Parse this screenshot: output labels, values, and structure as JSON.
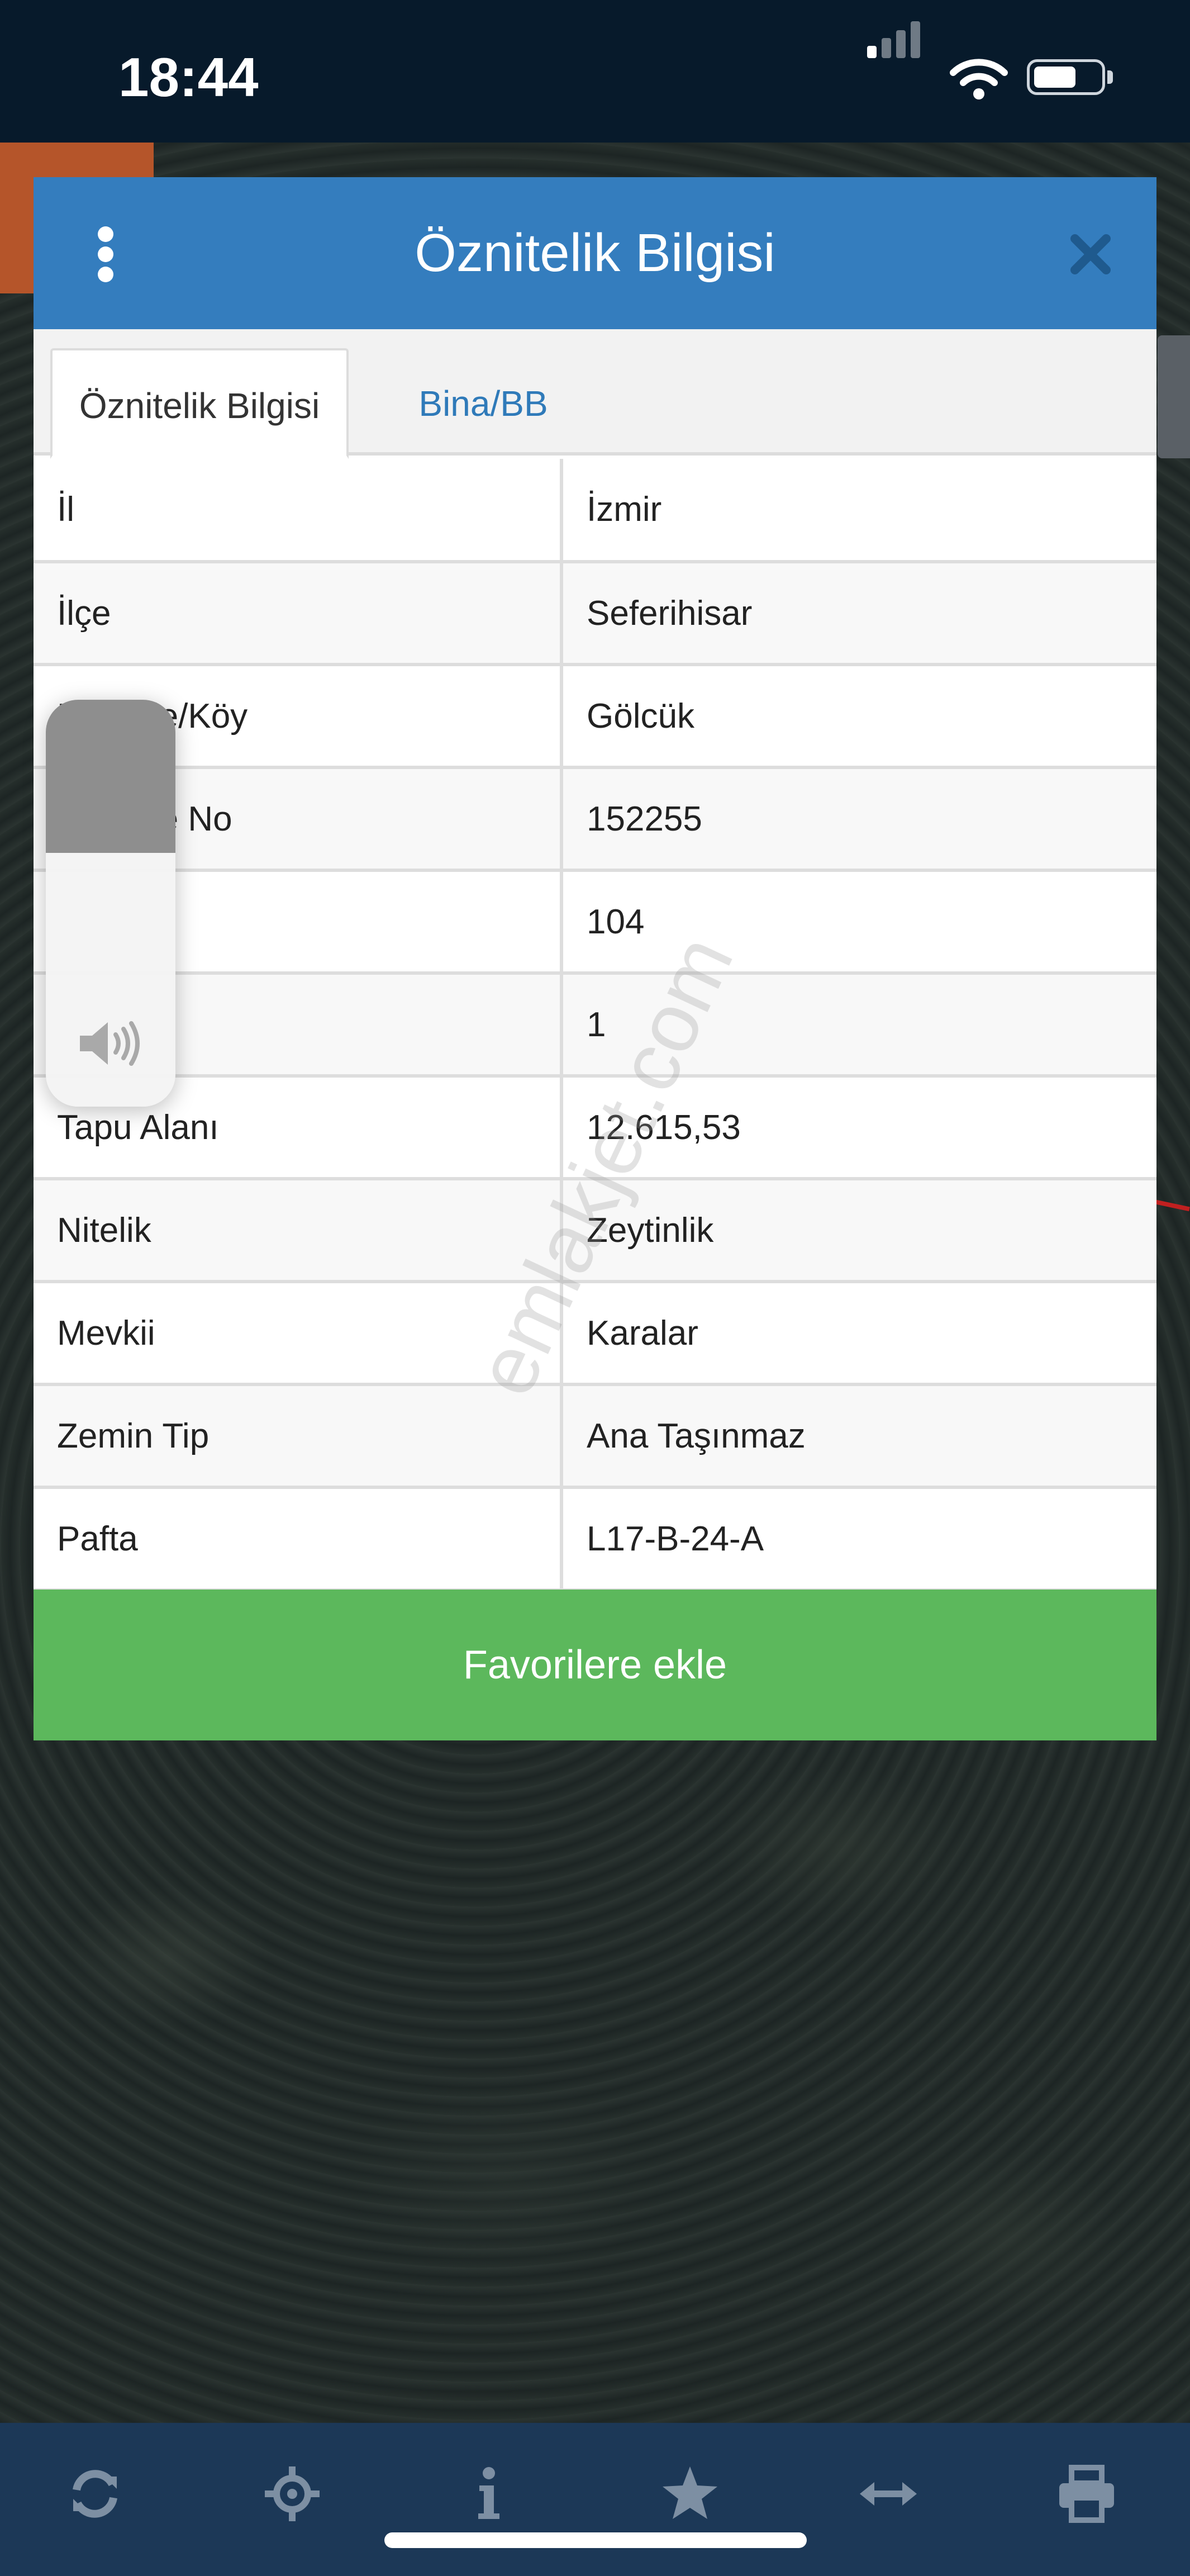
{
  "status_bar": {
    "time": "18:44",
    "signal_bars_active": 1,
    "signal_bars_total": 4,
    "battery_level": 0.65
  },
  "dialog": {
    "title": "Öznitelik Bilgisi",
    "tabs": [
      {
        "label": "Öznitelik Bilgisi",
        "active": true
      },
      {
        "label": "Bina/BB Listesi",
        "active": false
      }
    ],
    "rows": [
      {
        "key": "İl",
        "value": "İzmir"
      },
      {
        "key": "İlçe",
        "value": "Seferihisar"
      },
      {
        "key": "Mahalle/Köy",
        "value": "Gölcük"
      },
      {
        "key": "Mahalle No",
        "value": "152255"
      },
      {
        "key": "",
        "value": "104"
      },
      {
        "key": "",
        "value": "1"
      },
      {
        "key": "Tapu Alanı",
        "value": "12.615,53"
      },
      {
        "key": "Nitelik",
        "value": "Zeytinlik"
      },
      {
        "key": "Mevkii",
        "value": "Karalar"
      },
      {
        "key": "Zemin Tip",
        "value": "Ana Taşınmaz"
      },
      {
        "key": "Pafta",
        "value": "L17-B-24-A"
      }
    ],
    "favorite_button": "Favorilere ekle"
  },
  "watermark": "emlakjet.com",
  "volume_level": 0.38,
  "toolbar": {
    "icons": [
      "refresh-icon",
      "locate-icon",
      "info-icon",
      "star-icon",
      "measure-icon",
      "print-icon"
    ]
  },
  "colors": {
    "header_blue": "#347dbe",
    "tab_link_blue": "#2f7ab9",
    "favorite_green": "#5cb85c",
    "toolbar_navy": "#1c3857",
    "status_bar": "#071a2b"
  }
}
